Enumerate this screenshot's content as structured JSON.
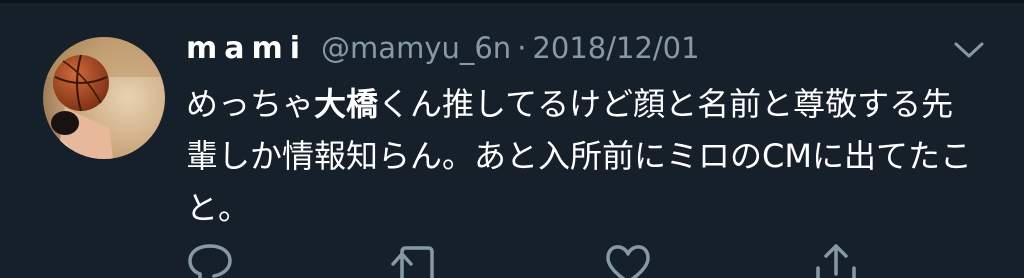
{
  "tweet": {
    "author": {
      "display_name": "mami",
      "handle": "@mamyu_6n"
    },
    "separator": "·",
    "date": "2018/12/01",
    "text": {
      "part1": "めっちゃ",
      "highlight": "大橋",
      "part2": "くん推してるけど顔と名前と尊敬する先輩しか情報知らん。あと入所前にミロのCMに出てたこと。"
    }
  },
  "icons": {
    "caret": "chevron-down-icon",
    "reply": "reply-icon",
    "retweet": "retweet-icon",
    "like": "heart-icon",
    "share": "share-icon"
  },
  "colors": {
    "background": "#15202b",
    "secondary_text": "#8899a6",
    "primary_text": "#ffffff"
  }
}
